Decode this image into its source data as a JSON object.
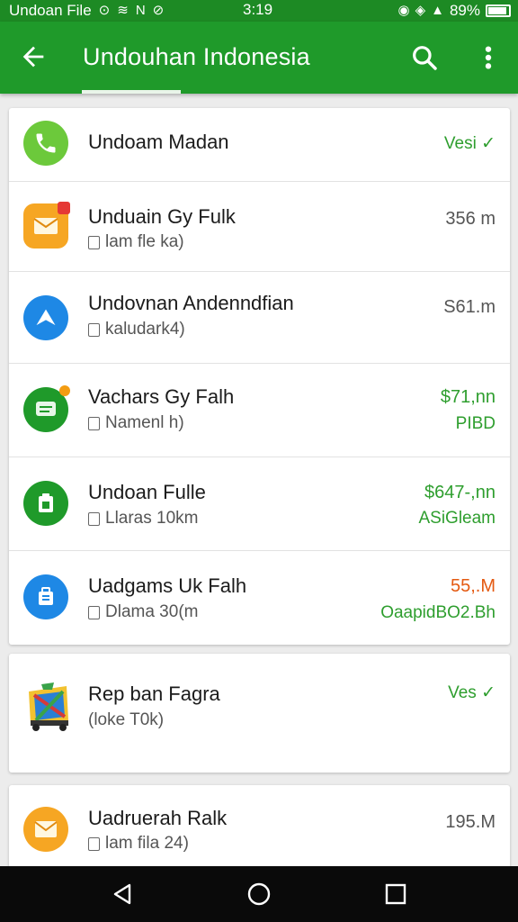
{
  "status_bar": {
    "notification_text": "Undoan File",
    "time": "3:19",
    "battery": "89%"
  },
  "app_bar": {
    "title": "Undouhan Indonesia"
  },
  "colors": {
    "primary": "#1f9a2a",
    "primary_dark": "#1d8a24",
    "amount_green": "#2e9e2e",
    "amount_orange": "#e45a12"
  },
  "list1": [
    {
      "icon": "phone-icon",
      "title": "Undoam Madan",
      "subtitle": "",
      "amount": "",
      "status": "Vesi ✓"
    },
    {
      "icon": "mail-icon",
      "title": "Unduain Gy Fulk",
      "subtitle": "lam fle ka)",
      "amount": "356 m",
      "status": ""
    },
    {
      "icon": "send-icon",
      "title": "Undovnan Andenndfian",
      "subtitle": "kaludark4)",
      "amount": "S61.m",
      "status": ""
    },
    {
      "icon": "message-icon",
      "title": "Vachars Gy Falh",
      "subtitle": "Namenl h)",
      "amount": "$71,nn",
      "status": "PIBD"
    },
    {
      "icon": "document-icon",
      "title": "Undoan Fulle",
      "subtitle": "Llaras 10km",
      "amount": "$647-,nn",
      "status": "ASiGleam"
    },
    {
      "icon": "briefcase-icon",
      "title": "Uadgams Uk Falh",
      "subtitle": "Dlama 30(m",
      "amount": "55,.M",
      "status": "OaapidBO2.Bh"
    }
  ],
  "list2": [
    {
      "icon": "game-icon",
      "title": "Rep ban Fagra",
      "subtitle": "(loke T0k)",
      "status": "Ves ✓"
    }
  ],
  "list3": [
    {
      "icon": "mail-icon",
      "title": "Uadruerah Ralk",
      "subtitle": "lam fila 24)",
      "amount": "195.M"
    }
  ]
}
